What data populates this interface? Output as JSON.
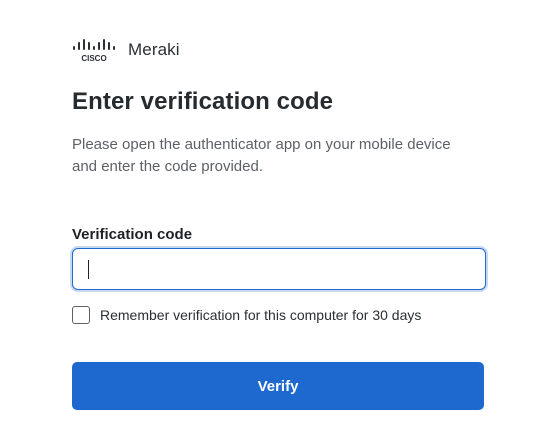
{
  "brand": {
    "logo_text": "CISCO",
    "product": "Meraki",
    "logo_icon": "cisco-logo-icon"
  },
  "title": "Enter verification code",
  "instructions": "Please open the authenticator app on your mobile device and enter the code provided.",
  "form": {
    "code_label": "Verification code",
    "code_value": "",
    "code_placeholder": "",
    "remember_label": "Remember verification for this computer for 30 days",
    "remember_checked": false,
    "submit_label": "Verify"
  },
  "colors": {
    "accent": "#1e69cf",
    "text": "#262b30",
    "muted": "#5d6166"
  }
}
